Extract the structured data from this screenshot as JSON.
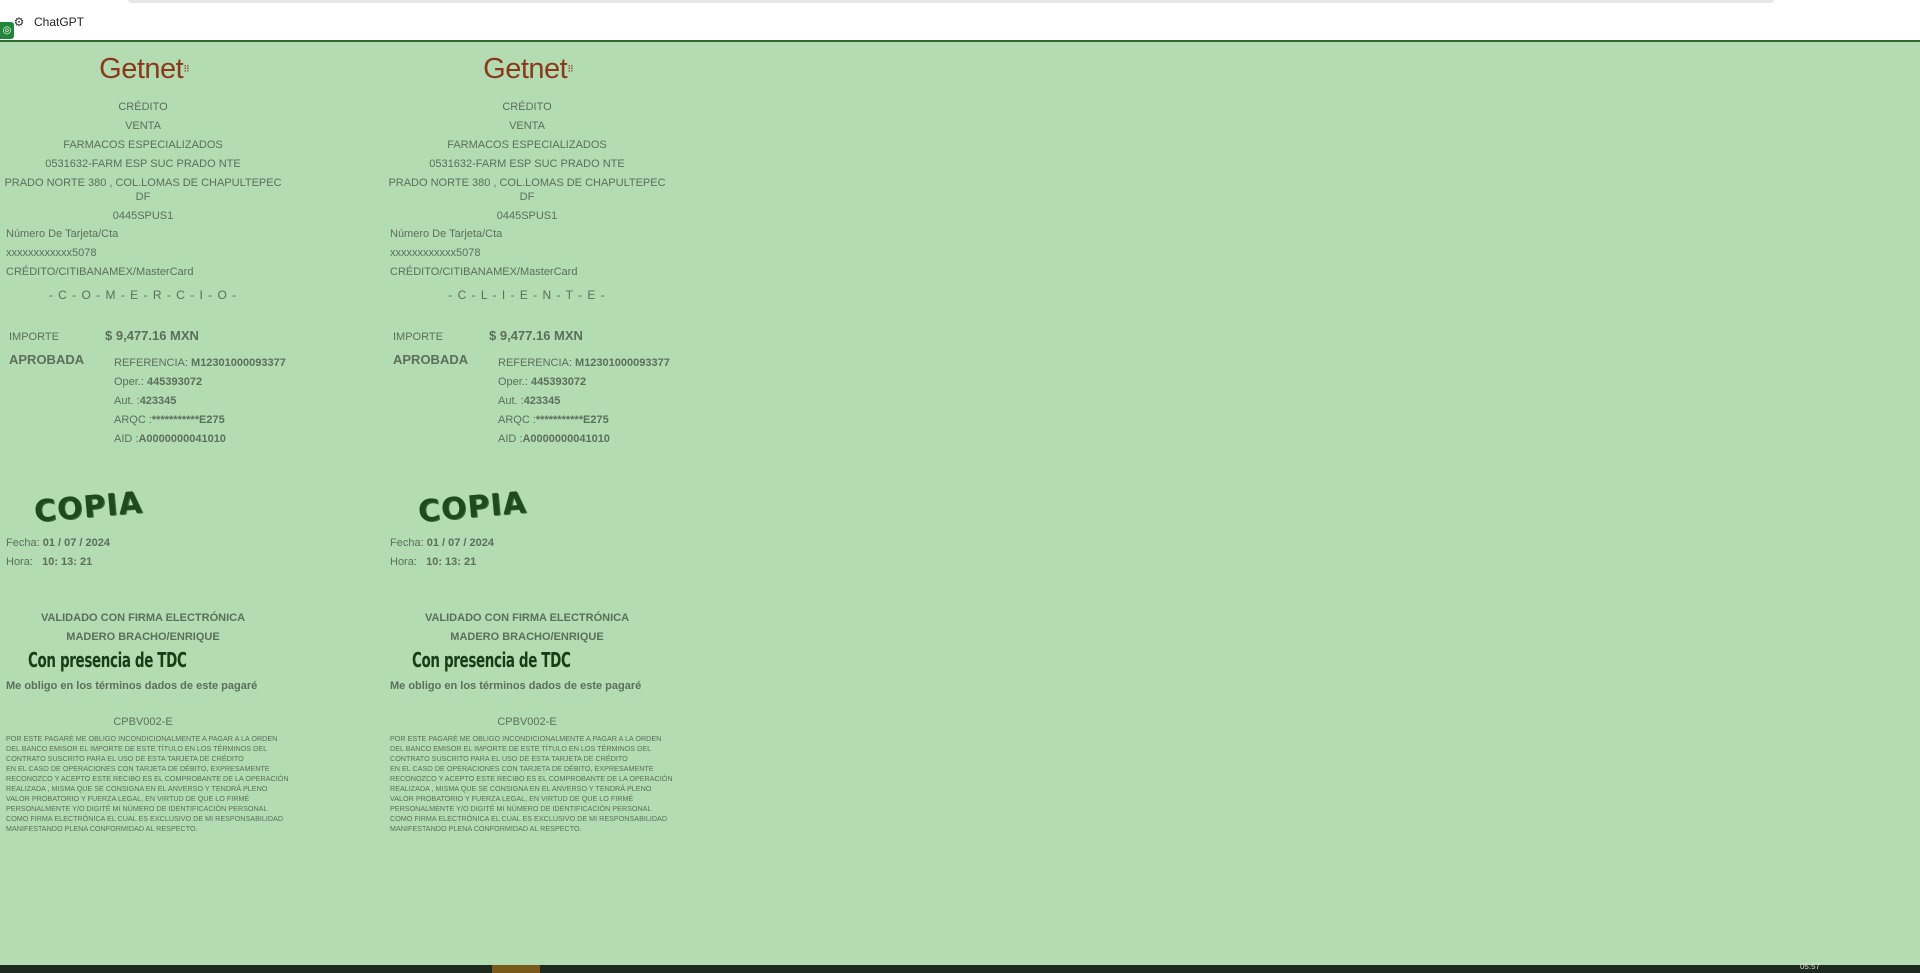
{
  "window": {
    "title": "ChatGPT",
    "gear_icon": "gear-icon",
    "extension_icon": "green-extension-icon"
  },
  "receipts": [
    {
      "logo": "Getnet",
      "type": "CRÉDITO",
      "operation": "VENTA",
      "merchant": "FARMACOS ESPECIALIZADOS",
      "branch": "0531632-FARM ESP SUC PRADO NTE",
      "address_line1": "PRADO NORTE 380 , COL.LOMAS DE CHAPULTEPEC",
      "address_line2": "DF",
      "terminal": "0445SPUS1",
      "card_label": "Número De Tarjeta/Cta",
      "card_number": "xxxxxxxxxxxx5078",
      "card_type": "CRÉDITO/CITIBANAMEX/MasterCard",
      "copy_for": "- C - O - M - E - R - C - I - O -",
      "amount_label": "IMPORTE",
      "amount": "$ 9,477.16 MXN",
      "status": "APROBADA",
      "ref_label": "REFERENCIA:",
      "ref": "M12301000093377",
      "oper_label": "Oper.:",
      "oper": "445393072",
      "aut_label": "Aut. :",
      "aut": "423345",
      "arqc_label": "ARQC :",
      "arqc": "***********E275",
      "aid_label": "AID :",
      "aid": "A0000000041010",
      "stamp": "COPIA",
      "fecha_label": "Fecha:",
      "fecha": "01 / 07 / 2024",
      "hora_label": "Hora:",
      "hora": "10: 13: 21",
      "validated": "VALIDADO CON FIRMA ELECTRÓNICA",
      "holder": "MADERO BRACHO/ENRIQUE",
      "presence": "Con presencia de TDC",
      "obligation": "Me obligo en los términos dados de este pagaré",
      "code": "CPBV002-E",
      "legal": [
        "POR ESTE PAGARÉ ME OBLIGO INCONDICIONALMENTE A PAGAR A LA ORDEN",
        "DEL BANCO EMISOR EL IMPORTE DE ESTE TÍTULO EN LOS TÉRMINOS DEL",
        "CONTRATO SUSCRITO PARA EL USO DE ESTA TARJETA DE CRÉDITO",
        "EN EL CASO DE OPERACIONES CON TARJETA DE DÉBITO, EXPRESAMENTE",
        "RECONOZCO Y ACEPTO ESTE RECIBO ES EL COMPROBANTE DE LA OPERACIÓN",
        "REALIZADA , MISMA QUE SE CONSIGNA EN EL ANVERSO Y TENDRÁ PLENO",
        "VALOR PROBATORIO Y FUERZA LEGAL, EN VIRTUD DE QUE LO FIRMÉ",
        "PERSONALMENTE Y/O DIGITÉ MI NÚMERO DE IDENTIFICACIÓN PERSONAL",
        "COMO FIRMA ELECTRÓNICA EL CUAL ES EXCLUSIVO DE MI RESPONSABILIDAD",
        "MANIFESTANDO PLENA CONFORMIDAD AL RESPECTO."
      ]
    },
    {
      "logo": "Getnet",
      "type": "CRÉDITO",
      "operation": "VENTA",
      "merchant": "FARMACOS ESPECIALIZADOS",
      "branch": "0531632-FARM ESP SUC PRADO NTE",
      "address_line1": "PRADO NORTE 380 , COL.LOMAS DE CHAPULTEPEC",
      "address_line2": "DF",
      "terminal": "0445SPUS1",
      "card_label": "Número De Tarjeta/Cta",
      "card_number": "xxxxxxxxxxxx5078",
      "card_type": "CRÉDITO/CITIBANAMEX/MasterCard",
      "copy_for": "- C - L - I - E - N - T - E -",
      "amount_label": "IMPORTE",
      "amount": "$ 9,477.16 MXN",
      "status": "APROBADA",
      "ref_label": "REFERENCIA:",
      "ref": "M12301000093377",
      "oper_label": "Oper.:",
      "oper": "445393072",
      "aut_label": "Aut. :",
      "aut": "423345",
      "arqc_label": "ARQC :",
      "arqc": "***********E275",
      "aid_label": "AID :",
      "aid": "A0000000041010",
      "stamp": "COPIA",
      "fecha_label": "Fecha:",
      "fecha": "01 / 07 / 2024",
      "hora_label": "Hora:",
      "hora": "10: 13: 21",
      "validated": "VALIDADO CON FIRMA ELECTRÓNICA",
      "holder": "MADERO BRACHO/ENRIQUE",
      "presence": "Con presencia de TDC",
      "obligation": "Me obligo en los términos dados de este pagaré",
      "code": "CPBV002-E",
      "legal": [
        "POR ESTE PAGARÉ ME OBLIGO INCONDICIONALMENTE A PAGAR A LA ORDEN",
        "DEL BANCO EMISOR EL IMPORTE DE ESTE TÍTULO EN LOS TÉRMINOS DEL",
        "CONTRATO SUSCRITO PARA EL USO DE ESTA TARJETA DE CRÉDITO",
        "EN EL CASO DE OPERACIONES CON TARJETA DE DÉBITO, EXPRESAMENTE",
        "RECONOZCO Y ACEPTO ESTE RECIBO ES EL COMPROBANTE DE LA OPERACIÓN",
        "REALIZADA , MISMA QUE SE CONSIGNA EN EL ANVERSO Y TENDRÁ PLENO",
        "VALOR PROBATORIO Y FUERZA LEGAL, EN VIRTUD DE QUE LO FIRMÉ",
        "PERSONALMENTE Y/O DIGITÉ MI NÚMERO DE IDENTIFICACIÓN PERSONAL",
        "COMO FIRMA ELECTRÓNICA EL CUAL ES EXCLUSIVO DE MI RESPONSABILIDAD",
        "MANIFESTANDO PLENA CONFORMIDAD AL RESPECTO."
      ]
    }
  ],
  "taskbar": {
    "clock": "05:57"
  }
}
